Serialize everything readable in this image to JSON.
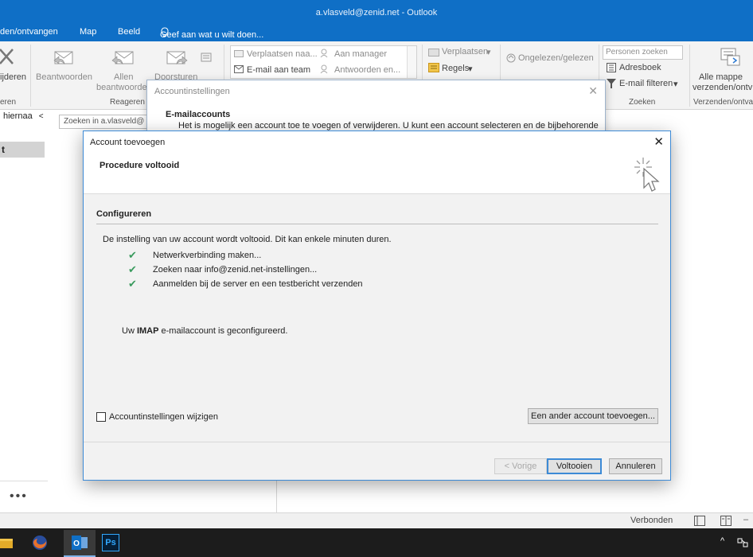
{
  "window": {
    "title": "a.vlasveld@zenid.net - Outlook"
  },
  "menu": {
    "send_receive": "den/ontvangen",
    "map": "Map",
    "beeld": "Beeld",
    "tell_me": "Geef aan wat u wilt doen..."
  },
  "ribbon": {
    "delete": "ijderen",
    "reply": "Beantwoorden",
    "reply_all_1": "Allen",
    "reply_all_2": "beantwoorden",
    "forward": "Doorsturen",
    "group_delete": "eren",
    "group_respond": "Reageren",
    "qs_move_to": "Verplaatsen naa...",
    "qs_manager": "Aan manager",
    "qs_team_email": "E-mail aan team",
    "qs_reply_delete": "Antwoorden en...",
    "move": "Verplaatsen",
    "rules": "Regels",
    "unread_read": "Ongelezen/gelezen",
    "search_people": "Personen zoeken",
    "address_book": "Adresboek",
    "filter_email": "E-mail filteren",
    "group_find": "Zoeken",
    "send_all_1": "Alle mappe",
    "send_all_2": "verzenden/ontv",
    "group_send": "Verzenden/ontva"
  },
  "nav": {
    "drag_here": "hiernaa",
    "search_mailbox": "Zoeken in a.vlasveld@",
    "folder_selected": "t",
    "more": "•••"
  },
  "status": {
    "connected": "Verbonden"
  },
  "account_settings_dialog": {
    "title": "Accountinstellingen",
    "heading": "E-mailaccounts",
    "description": "Het is mogelijk een account toe te voegen of verwijderen. U kunt een account selecteren en de bijbehorende"
  },
  "add_account_dialog": {
    "title": "Account toevoegen",
    "header": "Procedure voltooid",
    "section": "Configureren",
    "intro": "De instelling van uw account wordt voltooid. Dit kan enkele minuten duren.",
    "steps": [
      "Netwerkverbinding maken...",
      "Zoeken naar info@zenid.net-instellingen...",
      "Aanmelden bij de server en een testbericht verzenden"
    ],
    "result_prefix": "Uw ",
    "result_bold": "IMAP",
    "result_suffix": " e-mailaccount is geconfigureerd.",
    "checkbox_label": "Accountinstellingen wijzigen",
    "add_another": "Een ander account toevoegen...",
    "back": "< Vorige",
    "finish": "Voltooien",
    "cancel": "Annuleren"
  },
  "colors": {
    "accent": "#0f6fc6",
    "check": "#3a9b5e"
  }
}
